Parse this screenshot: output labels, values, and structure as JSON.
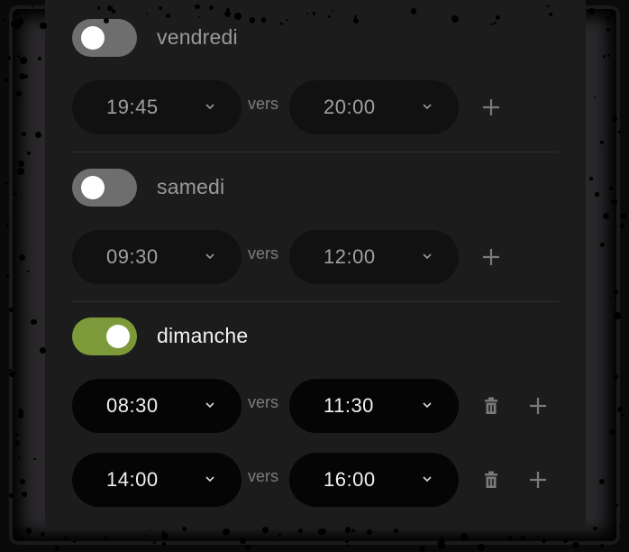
{
  "connector_label": "vers",
  "days": [
    {
      "name": "vendredi",
      "enabled": false,
      "slots": [
        {
          "from": "19:45",
          "to": "20:00",
          "can_delete": false
        }
      ]
    },
    {
      "name": "samedi",
      "enabled": false,
      "slots": [
        {
          "from": "09:30",
          "to": "12:00",
          "can_delete": false
        }
      ]
    },
    {
      "name": "dimanche",
      "enabled": true,
      "slots": [
        {
          "from": "08:30",
          "to": "11:30",
          "can_delete": true
        },
        {
          "from": "14:00",
          "to": "16:00",
          "can_delete": true
        }
      ]
    }
  ],
  "icons": {
    "add": "plus-icon",
    "delete": "trash-icon",
    "dropdown": "chevron-down-icon"
  },
  "colors": {
    "toggle_on": "#7d9a3a",
    "toggle_off": "#6e6e6e",
    "panel_bg": "#1c1c1c"
  }
}
